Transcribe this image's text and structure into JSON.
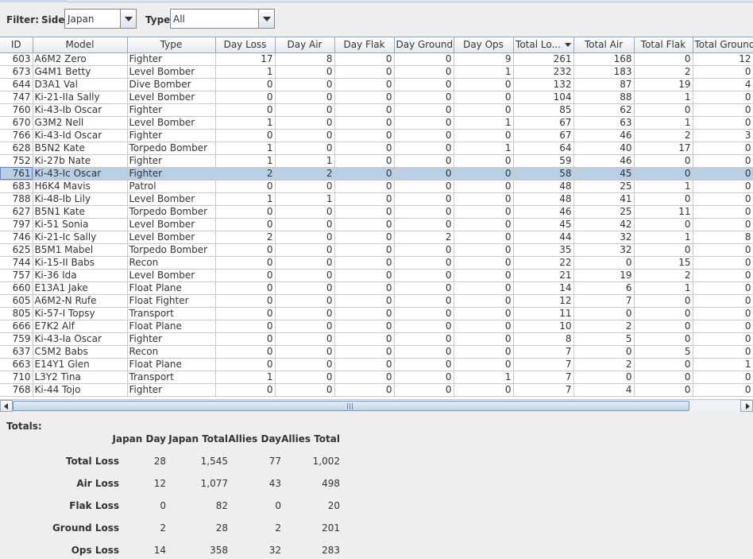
{
  "filter": {
    "label": "Filter:",
    "side_label": "Side:",
    "side_value": "Japan",
    "type_label": "Type:",
    "type_value": "All"
  },
  "table": {
    "columns": [
      "ID",
      "Model",
      "Type",
      "Day Loss",
      "Day Air",
      "Day Flak",
      "Day Ground",
      "Day Ops",
      "Total Lo...",
      "Total Air",
      "Total Flak",
      "Total Ground"
    ],
    "sorted_column": 8,
    "selected_row": 9,
    "rows": [
      [
        "603",
        "A6M2 Zero",
        "Fighter",
        "17",
        "8",
        "0",
        "0",
        "9",
        "261",
        "168",
        "0",
        "12"
      ],
      [
        "673",
        "G4M1 Betty",
        "Level Bomber",
        "1",
        "0",
        "0",
        "0",
        "1",
        "232",
        "183",
        "2",
        "0"
      ],
      [
        "644",
        "D3A1 Val",
        "Dive Bomber",
        "0",
        "0",
        "0",
        "0",
        "0",
        "132",
        "87",
        "19",
        "4"
      ],
      [
        "747",
        "Ki-21-IIa Sally",
        "Level Bomber",
        "0",
        "0",
        "0",
        "0",
        "0",
        "104",
        "88",
        "1",
        "0"
      ],
      [
        "760",
        "Ki-43-Ib Oscar",
        "Fighter",
        "0",
        "0",
        "0",
        "0",
        "0",
        "85",
        "62",
        "0",
        "0"
      ],
      [
        "670",
        "G3M2 Nell",
        "Level Bomber",
        "1",
        "0",
        "0",
        "0",
        "1",
        "67",
        "63",
        "1",
        "0"
      ],
      [
        "766",
        "Ki-43-Id Oscar",
        "Fighter",
        "0",
        "0",
        "0",
        "0",
        "0",
        "67",
        "46",
        "2",
        "3"
      ],
      [
        "628",
        "B5N2 Kate",
        "Torpedo Bomber",
        "1",
        "0",
        "0",
        "0",
        "1",
        "64",
        "40",
        "17",
        "0"
      ],
      [
        "752",
        "Ki-27b Nate",
        "Fighter",
        "1",
        "1",
        "0",
        "0",
        "0",
        "59",
        "46",
        "0",
        "0"
      ],
      [
        "761",
        "Ki-43-Ic Oscar",
        "Fighter",
        "2",
        "2",
        "0",
        "0",
        "0",
        "58",
        "45",
        "0",
        "0"
      ],
      [
        "683",
        "H6K4 Mavis",
        "Patrol",
        "0",
        "0",
        "0",
        "0",
        "0",
        "48",
        "25",
        "1",
        "0"
      ],
      [
        "788",
        "Ki-48-Ib Lily",
        "Level Bomber",
        "1",
        "1",
        "0",
        "0",
        "0",
        "48",
        "41",
        "0",
        "0"
      ],
      [
        "627",
        "B5N1 Kate",
        "Torpedo Bomber",
        "0",
        "0",
        "0",
        "0",
        "0",
        "46",
        "25",
        "11",
        "0"
      ],
      [
        "797",
        "Ki-51 Sonia",
        "Level Bomber",
        "0",
        "0",
        "0",
        "0",
        "0",
        "45",
        "42",
        "0",
        "0"
      ],
      [
        "746",
        "Ki-21-Ic Sally",
        "Level Bomber",
        "2",
        "0",
        "0",
        "2",
        "0",
        "44",
        "32",
        "1",
        "8"
      ],
      [
        "625",
        "B5M1 Mabel",
        "Torpedo Bomber",
        "0",
        "0",
        "0",
        "0",
        "0",
        "35",
        "32",
        "0",
        "0"
      ],
      [
        "744",
        "Ki-15-II Babs",
        "Recon",
        "0",
        "0",
        "0",
        "0",
        "0",
        "22",
        "0",
        "15",
        "0"
      ],
      [
        "757",
        "Ki-36 Ida",
        "Level Bomber",
        "0",
        "0",
        "0",
        "0",
        "0",
        "21",
        "19",
        "2",
        "0"
      ],
      [
        "660",
        "E13A1 Jake",
        "Float Plane",
        "0",
        "0",
        "0",
        "0",
        "0",
        "14",
        "6",
        "1",
        "0"
      ],
      [
        "605",
        "A6M2-N Rufe",
        "Float Fighter",
        "0",
        "0",
        "0",
        "0",
        "0",
        "12",
        "7",
        "0",
        "0"
      ],
      [
        "805",
        "Ki-57-I Topsy",
        "Transport",
        "0",
        "0",
        "0",
        "0",
        "0",
        "11",
        "0",
        "0",
        "0"
      ],
      [
        "666",
        "E7K2 Alf",
        "Float Plane",
        "0",
        "0",
        "0",
        "0",
        "0",
        "10",
        "2",
        "0",
        "0"
      ],
      [
        "759",
        "Ki-43-Ia Oscar",
        "Fighter",
        "0",
        "0",
        "0",
        "0",
        "0",
        "8",
        "5",
        "0",
        "0"
      ],
      [
        "637",
        "C5M2 Babs",
        "Recon",
        "0",
        "0",
        "0",
        "0",
        "0",
        "7",
        "0",
        "5",
        "0"
      ],
      [
        "663",
        "E14Y1 Glen",
        "Float Plane",
        "0",
        "0",
        "0",
        "0",
        "0",
        "7",
        "2",
        "0",
        "1"
      ],
      [
        "710",
        "L3Y2 Tina",
        "Transport",
        "1",
        "0",
        "0",
        "0",
        "1",
        "7",
        "0",
        "0",
        "0"
      ],
      [
        "768",
        "Ki-44 Tojo",
        "Fighter",
        "0",
        "0",
        "0",
        "0",
        "0",
        "7",
        "4",
        "0",
        "0"
      ]
    ]
  },
  "totals": {
    "title": "Totals:",
    "headers": [
      "Japan Day",
      "Japan Total",
      "Allies Day",
      "Allies Total"
    ],
    "rows": [
      {
        "label": "Total Loss",
        "values": [
          "28",
          "1,545",
          "77",
          "1,002"
        ]
      },
      {
        "label": "Air Loss",
        "values": [
          "12",
          "1,077",
          "43",
          "498"
        ]
      },
      {
        "label": "Flak Loss",
        "values": [
          "0",
          "82",
          "0",
          "20"
        ]
      },
      {
        "label": "Ground Loss",
        "values": [
          "2",
          "28",
          "2",
          "201"
        ]
      },
      {
        "label": "Ops Loss",
        "values": [
          "14",
          "358",
          "32",
          "283"
        ]
      }
    ]
  },
  "icons": {
    "dropdown": "chevron-down-icon",
    "sort": "sort-descending-icon",
    "scroll_left": "arrow-left-icon",
    "scroll_right": "arrow-right-icon"
  },
  "colors": {
    "selection": "#b8cfe5",
    "grid": "#c8c8c8",
    "background": "#eeeeee"
  }
}
